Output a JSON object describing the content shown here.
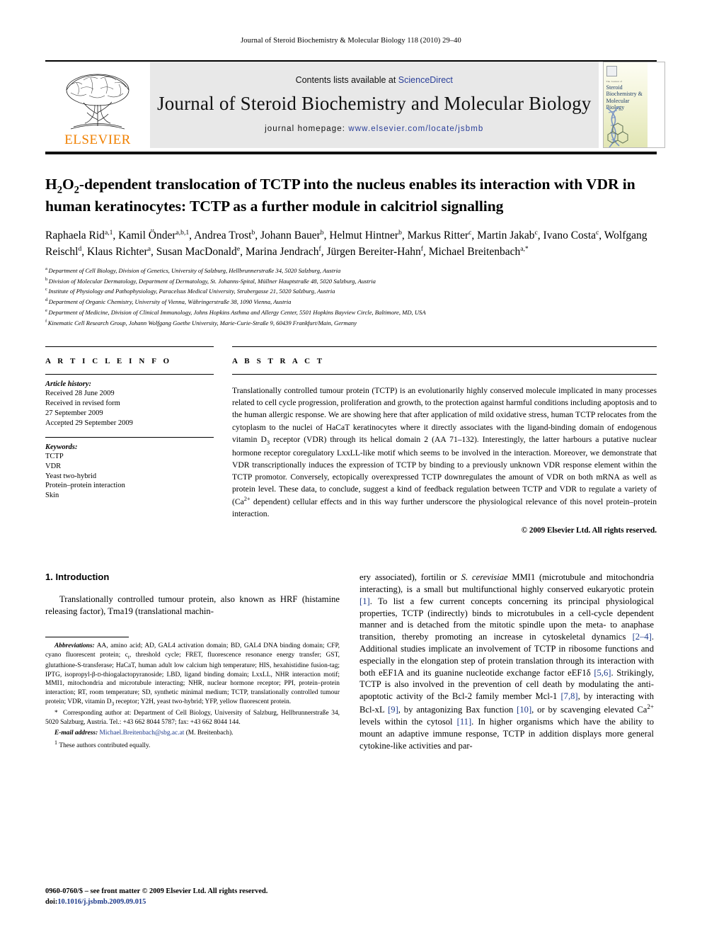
{
  "running_head": "Journal of Steroid Biochemistry & Molecular Biology 118 (2010) 29–40",
  "masthead": {
    "contents_prefix": "Contents lists available at ",
    "contents_link": "ScienceDirect",
    "journal_title": "Journal of Steroid Biochemistry and Molecular Biology",
    "homepage_label": "journal homepage:",
    "homepage_url": "www.elsevier.com/locate/jsbmb",
    "publisher": "ELSEVIER",
    "cover": {
      "kicker": "The Journal of",
      "title": "Steroid Biochemistry & Molecular Biology"
    },
    "accent_color": "#2a3f99",
    "elsevier_color": "#F08000"
  },
  "article": {
    "title_html": "H<sub>2</sub>O<sub>2</sub>-dependent translocation of TCTP into the nucleus enables its interaction with VDR in human keratinocytes: TCTP as a further module in calcitriol signalling",
    "authors_html": "Raphaela Rid<sup>a,1</sup>, Kamil Önder<sup>a,b,1</sup>, Andrea Trost<sup>b</sup>, Johann Bauer<sup>b</sup>, Helmut Hintner<sup>b</sup>, Markus Ritter<sup>c</sup>, Martin Jakab<sup>c</sup>, Ivano Costa<sup>c</sup>, Wolfgang Reischl<sup>d</sup>, Klaus Richter<sup>a</sup>, Susan MacDonald<sup>e</sup>, Marina Jendrach<sup>f</sup>, Jürgen Bereiter-Hahn<sup>f</sup>, Michael Breitenbach<sup>a,*</sup>",
    "affiliations": [
      {
        "mark": "a",
        "text": "Department of Cell Biology, Division of Genetics, University of Salzburg, Hellbrunnerstraße 34, 5020 Salzburg, Austria"
      },
      {
        "mark": "b",
        "text": "Division of Molecular Dermatology, Department of Dermatology, St. Johanns-Spital, Müllner Hauptstraße 48, 5020 Salzburg, Austria"
      },
      {
        "mark": "c",
        "text": "Institute of Physiology and Pathophysiology, Paracelsus Medical University, Strubergasse 21, 5020 Salzburg, Austria"
      },
      {
        "mark": "d",
        "text": "Department of Organic Chemistry, University of Vienna, Währingerstraße 38, 1090 Vienna, Austria"
      },
      {
        "mark": "e",
        "text": "Department of Medicine, Division of Clinical Immunology, Johns Hopkins Asthma and Allergy Center, 5501 Hopkins Bayview Circle, Baltimore, MD, USA"
      },
      {
        "mark": "f",
        "text": "Kinematic Cell Research Group, Johann Wolfgang Goethe University, Marie-Curie-Straße 9, 60439 Frankfurt/Main, Germany"
      }
    ]
  },
  "article_info": {
    "heading": "A R T I C L E  I N F O",
    "history": {
      "label": "Article history:",
      "lines": [
        "Received 28 June 2009",
        "Received in revised form",
        "27 September 2009",
        "Accepted 29 September 2009"
      ]
    },
    "keywords": {
      "label": "Keywords:",
      "lines": [
        "TCTP",
        "VDR",
        "Yeast two-hybrid",
        "Protein–protein interaction",
        "Skin"
      ]
    }
  },
  "abstract": {
    "heading": "A B S T R A C T",
    "body_html": "Translationally controlled tumour protein (TCTP) is an evolutionarily highly conserved molecule implicated in many processes related to cell cycle progression, proliferation and growth, to the protection against harmful conditions including apoptosis and to the human allergic response. We are showing here that after application of mild oxidative stress, human TCTP relocates from the cytoplasm to the nuclei of HaCaT keratinocytes where it directly associates with the ligand-binding domain of endogenous vitamin D<sub>3</sub> receptor (VDR) through its helical domain 2 (AA 71–132). Interestingly, the latter harbours a putative nuclear hormone receptor coregulatory LxxLL-like motif which seems to be involved in the interaction. Moreover, we demonstrate that VDR transcriptionally induces the expression of TCTP by binding to a previously unknown VDR response element within the TCTP promotor. Conversely, ectopically overexpressed TCTP downregulates the amount of VDR on both mRNA as well as protein level. These data, to conclude, suggest a kind of feedback regulation between TCTP and VDR to regulate a variety of (Ca<sup>2+</sup> dependent) cellular effects and in this way further underscore the physiological relevance of this novel protein–protein interaction.",
    "copyright": "© 2009 Elsevier Ltd. All rights reserved."
  },
  "introduction": {
    "heading": "1.  Introduction",
    "left_par_html": "Translationally controlled tumour protein, also known as HRF (histamine releasing factor), Tma19 (translational machin-",
    "right_par_html": "ery associated), fortilin or <i>S. cerevisiae</i> MMI1 (microtubule and mitochondria interacting), is a small but multifunctional highly conserved eukaryotic protein <span class=\"ref\">[1]</span>. To list a few current concepts concerning its principal physiological properties, TCTP (indirectly) binds to microtubules in a cell-cycle dependent manner and is detached from the mitotic spindle upon the meta- to anaphase transition, thereby promoting an increase in cytoskeletal dynamics <span class=\"ref\">[2–4]</span>. Additional studies implicate an involvement of TCTP in ribosome functions and especially in the elongation step of protein translation through its interaction with both eEF1A and its guanine nucleotide exchange factor eEF1δ <span class=\"ref\">[5,6]</span>. Strikingly, TCTP is also involved in the prevention of cell death by modulating the anti-apoptotic activity of the Bcl-2 family member Mcl-1 <span class=\"ref\">[7,8]</span>, by interacting with Bcl-xL <span class=\"ref\">[9]</span>, by antagonizing Bax function <span class=\"ref\">[10]</span>, or by scavenging elevated Ca<sup>2+</sup> levels within the cytosol <span class=\"ref\">[11]</span>. In higher organisms which have the ability to mount an adaptive immune response, TCTP in addition displays more general cytokine-like activities and par-"
  },
  "footnotes": {
    "abbreviations_label": "Abbreviations:",
    "abbreviations_html": " AA, amino acid; AD, GAL4 activation domain; BD, GAL4 DNA binding domain; CFP, cyano fluorescent protein; c<sub>t</sub>, threshold cycle; FRET, fluorescence resonance energy transfer; GST, glutathione-S-transferase; HaCaT, human adult low calcium high temperature; HIS, hexahistidine fusion-tag; IPTG, isopropyl-β-<span style=\"font-variant:small-caps\">d</span>-thiogalactopyranoside; LBD, ligand binding domain; LxxLL, NHR interaction motif; MMI1, mitochondria and microtubule interacting; NHR, nuclear hormone receptor; PPI, protein–protein interaction; RT, room temperature; SD, synthetic minimal medium; TCTP, translationally controlled tumour protein; VDR, vitamin D<sub>3</sub> receptor; Y2H, yeast two-hybrid; YFP, yellow fluorescent protein.",
    "corresponding_html": "Corresponding author at: Department of Cell Biology, University of Salzburg, Hellbrunnerstraße 34, 5020 Salzburg, Austria. Tel.: +43 662 8044 5787; fax: +43 662 8044 144.",
    "email_label": "E-mail address:",
    "email_address": "Michael.Breitenbach@sbg.ac.at",
    "email_suffix": " (M. Breitenbach).",
    "equal_contribution": "These authors contributed equally."
  },
  "page_footer": {
    "front_matter": "0960-0760/$ – see front matter © 2009 Elsevier Ltd. All rights reserved.",
    "doi_label": "doi:",
    "doi_value": "10.1016/j.jsbmb.2009.09.015"
  }
}
